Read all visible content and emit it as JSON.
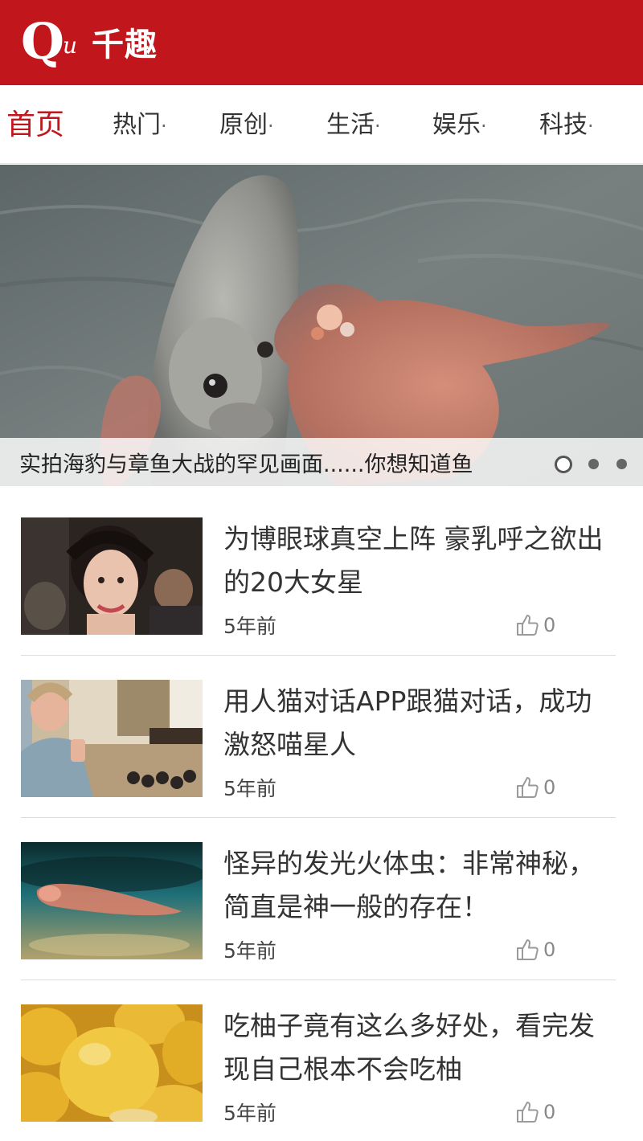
{
  "header": {
    "logo_q": "Q",
    "logo_u": "u",
    "logo_text": "千趣"
  },
  "nav": {
    "items": [
      {
        "label": "首页",
        "active": true
      },
      {
        "label": "热门",
        "active": false
      },
      {
        "label": "原创",
        "active": false
      },
      {
        "label": "生活",
        "active": false
      },
      {
        "label": "娱乐",
        "active": false
      },
      {
        "label": "科技",
        "active": false
      }
    ],
    "separator": "·"
  },
  "slider": {
    "caption": "实拍海豹与章鱼大战的罕见画面......你想知道鱼",
    "total_dots": 3,
    "active_dot": 1
  },
  "news": [
    {
      "title": "为博眼球真空上阵 豪乳呼之欲出的20大女星",
      "time": "5年前",
      "likes": "0",
      "thumb": "woman-portrait"
    },
    {
      "title": "用人猫对话APP跟猫对话，成功激怒喵星人",
      "time": "5年前",
      "likes": "0",
      "thumb": "man-living-room"
    },
    {
      "title": "怪异的发光火体虫：非常神秘，简直是神一般的存在！",
      "time": "5年前",
      "likes": "0",
      "thumb": "underwater-creature"
    },
    {
      "title": "吃柚子竟有这么多好处，看完发现自己根本不会吃柚",
      "time": "5年前",
      "likes": "0",
      "thumb": "pomelos"
    }
  ],
  "colors": {
    "brand_red": "#c0161c",
    "text": "#333333",
    "muted": "#888888"
  }
}
